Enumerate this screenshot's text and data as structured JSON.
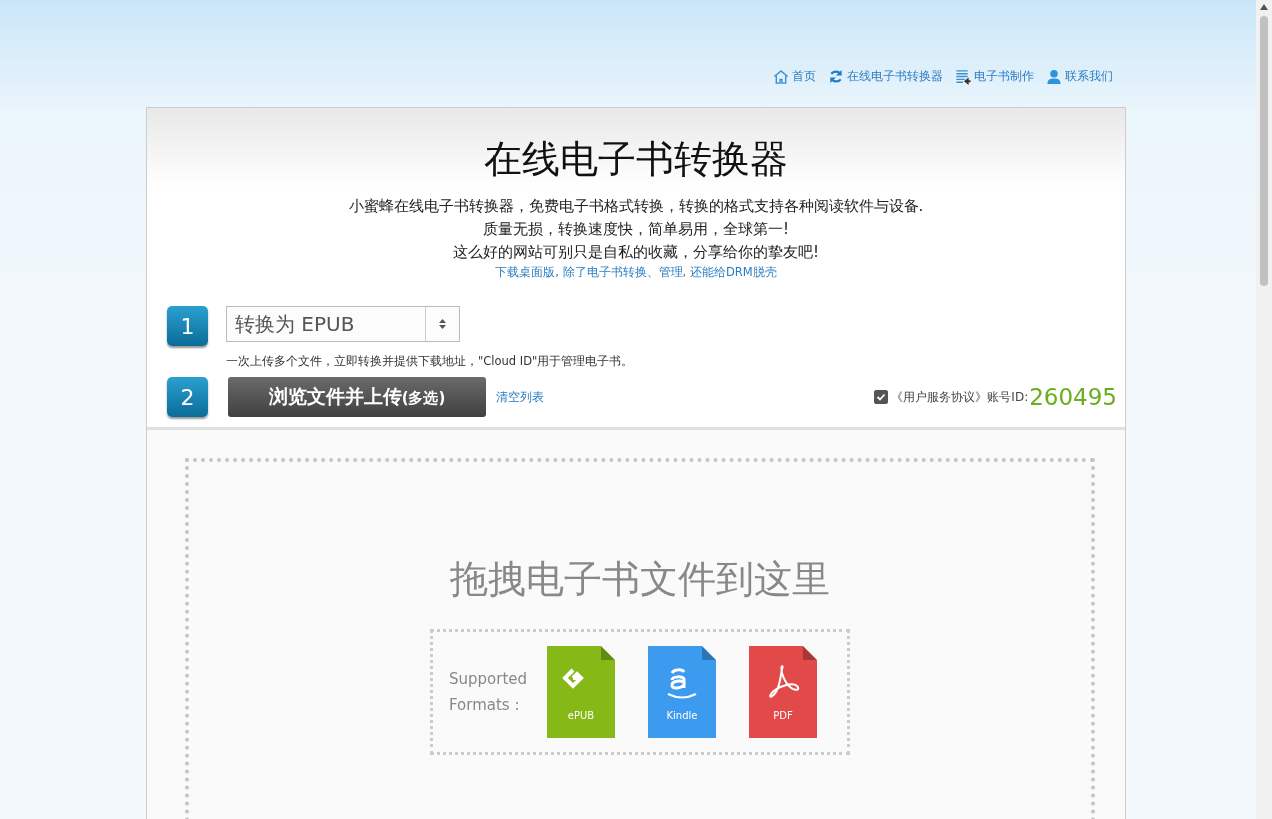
{
  "nav": [
    {
      "kind": "home",
      "label": "首页"
    },
    {
      "kind": "refresh",
      "label": "在线电子书转换器"
    },
    {
      "kind": "document",
      "label": "电子书制作"
    },
    {
      "kind": "person",
      "label": "联系我们"
    }
  ],
  "header": {
    "title": "在线电子书转换器",
    "lines": [
      "小蜜蜂在线电子书转换器，免费电子书格式转换，转换的格式支持各种阅读软件与设备.",
      "质量无损，转换速度快，简单易用，全球第一!",
      "这么好的网站可别只是自私的收藏，分享给你的挚友吧!"
    ],
    "link": "下载桌面版, 除了电子书转换、管理, 还能给DRM脱壳"
  },
  "step1": {
    "number": "1",
    "select": "转换为 EPUB",
    "hint": "一次上传多个文件，立即转换并提供下载地址，\"Cloud ID\"用于管理电子书。"
  },
  "step2": {
    "number": "2",
    "button": {
      "label": "浏览文件并上传",
      "suffix": "(多选)"
    },
    "clear": "清空列表",
    "agreement": {
      "checked": true,
      "label": "《用户服务协议》"
    },
    "account_label": "账号ID:",
    "account_id": "260495"
  },
  "dropzone": {
    "title": "拖拽电子书文件到这里",
    "supported": "Supported Formats :",
    "formats": [
      {
        "kind": "epub",
        "label": "ePUB",
        "color": "#86b817"
      },
      {
        "kind": "kindle",
        "label": "Kindle",
        "color": "#3d9bef"
      },
      {
        "kind": "pdf",
        "label": "PDF",
        "color": "#e24a4a"
      }
    ]
  }
}
